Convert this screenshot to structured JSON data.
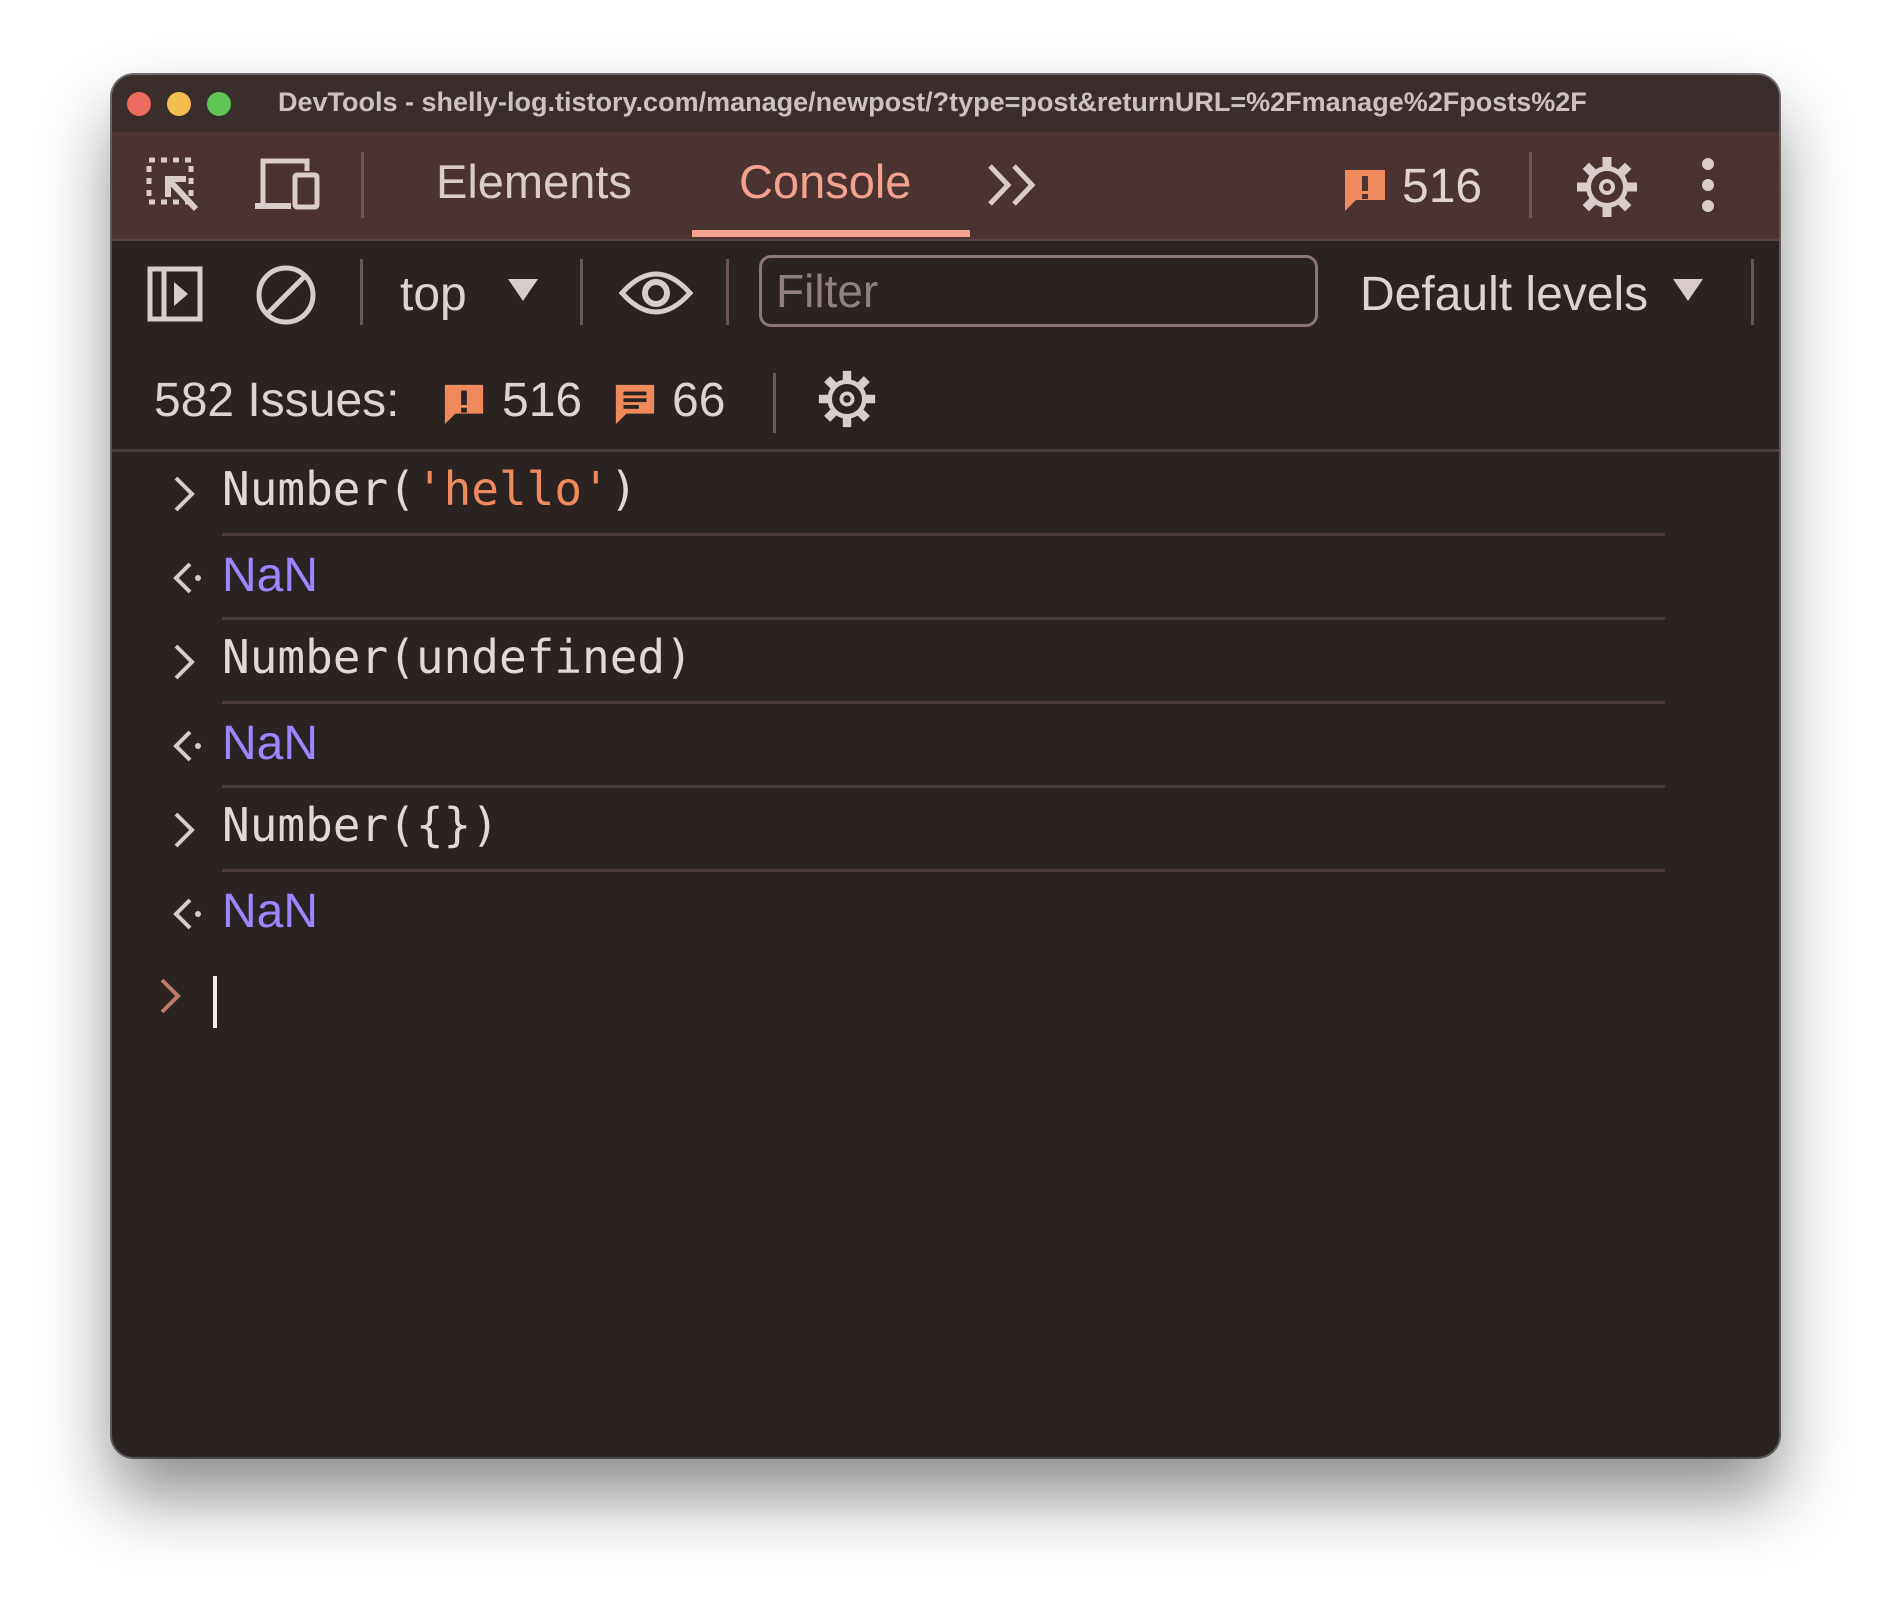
{
  "window": {
    "title": "DevTools - shelly-log.tistory.com/manage/newpost/?type=post&returnURL=%2Fmanage%2Fposts%2F"
  },
  "tabs": {
    "elements": "Elements",
    "console": "Console",
    "active": "Console",
    "issue_count": "516"
  },
  "toolbar": {
    "context": "top",
    "filter_placeholder": "Filter",
    "filter_value": "",
    "levels": "Default levels"
  },
  "issues": {
    "label": "582 Issues:",
    "warnings": "516",
    "messages": "66"
  },
  "console": {
    "entries": [
      {
        "type": "input",
        "prefix": "Number(",
        "string": "'hello'",
        "suffix": ")"
      },
      {
        "type": "output",
        "value": "NaN"
      },
      {
        "type": "input",
        "text": "Number(undefined)"
      },
      {
        "type": "output",
        "value": "NaN"
      },
      {
        "type": "input",
        "text": "Number({})"
      },
      {
        "type": "output",
        "value": "NaN"
      }
    ]
  },
  "colors": {
    "accent": "#f3a28f",
    "warning": "#f08a5d",
    "nan": "#9c86ff",
    "string": "#f08a5d",
    "background": "#2a2322",
    "tabbar": "#4a3330"
  },
  "icons": {
    "inspect": "inspect-element-icon",
    "device": "device-toolbar-icon",
    "more_tabs": "chevron-double-right-icon",
    "warning": "warning-badge-icon",
    "settings": "gear-icon",
    "menu": "kebab-menu-icon",
    "sidebar": "sidebar-toggle-icon",
    "clear": "clear-console-icon",
    "eye": "eye-icon",
    "message": "message-icon"
  }
}
